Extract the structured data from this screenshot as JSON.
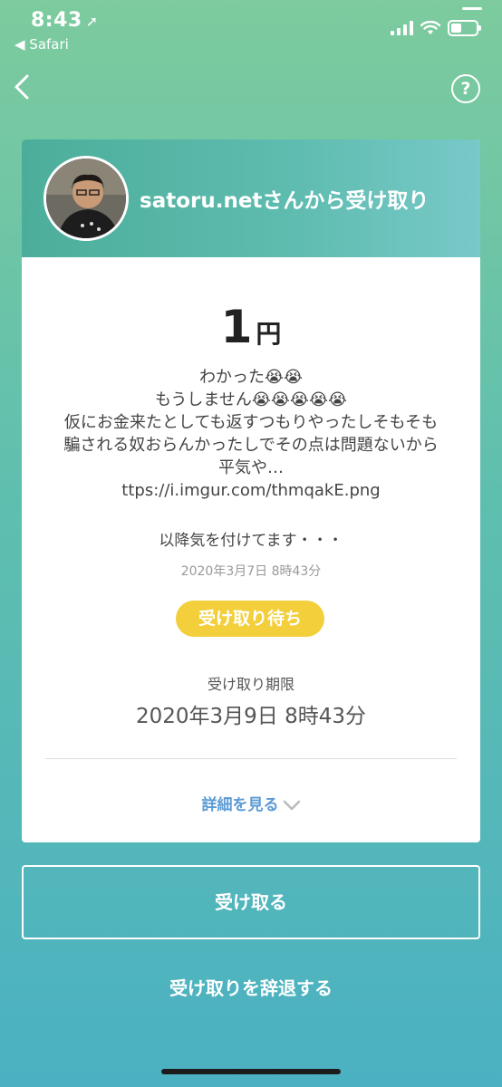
{
  "status_bar": {
    "time": "8:43",
    "back_app": "◀ Safari"
  },
  "sender": {
    "title": "satoru.netさんから受け取り",
    "avatar_icon": "avatar-photo"
  },
  "payment": {
    "amount": "1",
    "unit": "円",
    "message_lines": [
      "わかった😭😭",
      "もうしません😭😭😭😭😭",
      "仮にお金来たとしても返すつもりやったしそもそも騙される奴おらんかったしでその点は問題ないから平気や…",
      "ttps://i.imgur.com/thmqakE.png"
    ],
    "note": "以降気を付けてます・・・",
    "sent_date": "2020年3月7日 8時43分",
    "status": "受け取り待ち",
    "deadline_label": "受け取り期限",
    "deadline_value": "2020年3月9日 8時43分",
    "details_label": "詳細を見る"
  },
  "actions": {
    "receive": "受け取る",
    "decline": "受け取りを辞退する"
  },
  "colors": {
    "gradient_top": "#7dcb9e",
    "gradient_bottom": "#4bb1c2",
    "badge": "#f3cf3b",
    "link": "#5b9bd5"
  }
}
